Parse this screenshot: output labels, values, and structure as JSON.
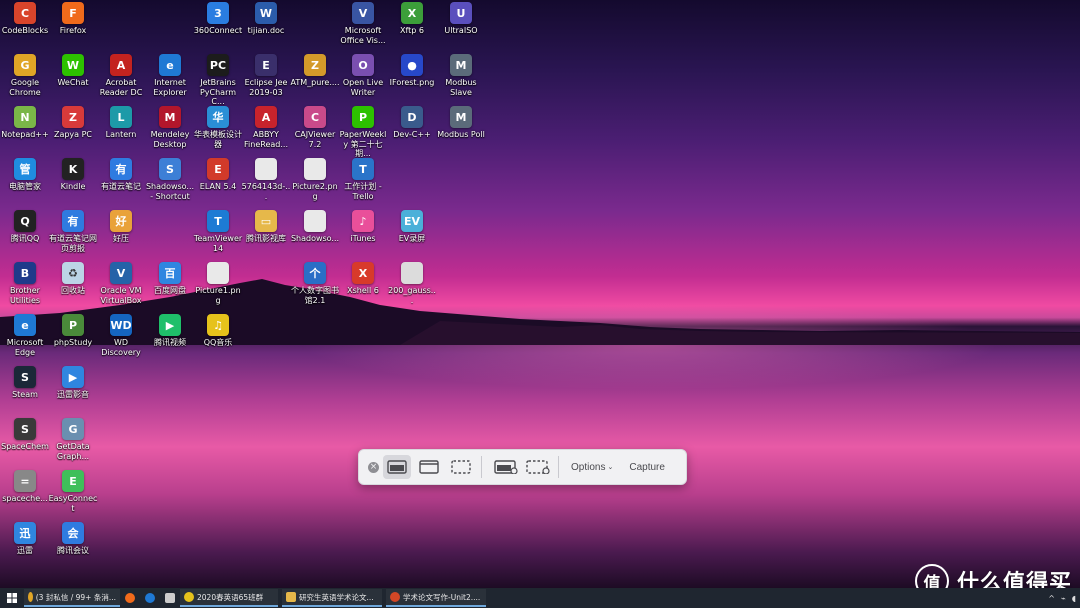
{
  "desktop": {
    "icons": [
      {
        "label": "CodeBlocks",
        "icon": "codeblocks-icon",
        "color": "#d9442b",
        "glyph": "C"
      },
      {
        "label": "Firefox",
        "icon": "firefox-icon",
        "color": "#f06a1b",
        "glyph": "F"
      },
      {
        "label": "360Connect",
        "icon": "360connect-icon",
        "color": "#2a7de1",
        "glyph": "3"
      },
      {
        "label": "tijian.doc",
        "icon": "word-doc-icon",
        "color": "#2b5cab",
        "glyph": "W"
      },
      {
        "label": "Microsoft Office Vis...",
        "icon": "visio-icon",
        "color": "#3955a3",
        "glyph": "V"
      },
      {
        "label": "Xftp 6",
        "icon": "xftp-icon",
        "color": "#3c9e3a",
        "glyph": "X"
      },
      {
        "label": "UltraISO",
        "icon": "ultraiso-icon",
        "color": "#5a4fbd",
        "glyph": "U"
      },
      {
        "label": "Google Chrome",
        "icon": "chrome-icon",
        "color": "#e0a526",
        "glyph": "G"
      },
      {
        "label": "WeChat",
        "icon": "wechat-icon",
        "color": "#2dc100",
        "glyph": "W"
      },
      {
        "label": "Acrobat Reader DC",
        "icon": "acrobat-icon",
        "color": "#c3231f",
        "glyph": "A"
      },
      {
        "label": "Internet Explorer",
        "icon": "ie-icon",
        "color": "#1f79d4",
        "glyph": "e"
      },
      {
        "label": "JetBrains PyCharm C...",
        "icon": "pycharm-icon",
        "color": "#1c1c1c",
        "glyph": "PC"
      },
      {
        "label": "Eclipse Jee 2019-03",
        "icon": "eclipse-icon",
        "color": "#3a2f6b",
        "glyph": "E"
      },
      {
        "label": "ATM_pure....",
        "icon": "archive-icon",
        "color": "#d49a2a",
        "glyph": "Z"
      },
      {
        "label": "Open Live Writer",
        "icon": "livewriter-icon",
        "color": "#7a4fb0",
        "glyph": "O"
      },
      {
        "label": "IForest.png",
        "icon": "image-file-icon",
        "color": "#2748c9",
        "glyph": "●"
      },
      {
        "label": "Modbus Slave",
        "icon": "modbus-slave-icon",
        "color": "#5b6b7a",
        "glyph": "M"
      },
      {
        "label": "Notepad++",
        "icon": "notepadpp-icon",
        "color": "#7ab648",
        "glyph": "N"
      },
      {
        "label": "Zapya PC",
        "icon": "zapya-icon",
        "color": "#d83a3a",
        "glyph": "Z"
      },
      {
        "label": "Lantern",
        "icon": "lantern-icon",
        "color": "#1d9aa8",
        "glyph": "L"
      },
      {
        "label": "Mendeley Desktop",
        "icon": "mendeley-icon",
        "color": "#b3162b",
        "glyph": "M"
      },
      {
        "label": "华表模板设计器",
        "icon": "huabiao-icon",
        "color": "#2a8fd6",
        "glyph": "华"
      },
      {
        "label": "ABBYY FineRead...",
        "icon": "abbyy-icon",
        "color": "#c8232c",
        "glyph": "A"
      },
      {
        "label": "CAJViewer 7.2",
        "icon": "cajviewer-icon",
        "color": "#c94a8a",
        "glyph": "C"
      },
      {
        "label": "PaperWeekly 第二十七期...",
        "icon": "wechat-file-icon",
        "color": "#2dc100",
        "glyph": "P"
      },
      {
        "label": "Dev-C++",
        "icon": "devcpp-icon",
        "color": "#3a5b8c",
        "glyph": "D"
      },
      {
        "label": "Modbus Poll",
        "icon": "modbus-poll-icon",
        "color": "#5b6b7a",
        "glyph": "M"
      },
      {
        "label": "电脑管家",
        "icon": "pc-manager-icon",
        "color": "#1f8ce0",
        "glyph": "管"
      },
      {
        "label": "Kindle",
        "icon": "kindle-icon",
        "color": "#222222",
        "glyph": "K"
      },
      {
        "label": "有道云笔记",
        "icon": "youdao-note-icon",
        "color": "#2f7be0",
        "glyph": "有"
      },
      {
        "label": "Shadowso... - Shortcut",
        "icon": "shadowsocks-icon",
        "color": "#3d7fd6",
        "glyph": "S"
      },
      {
        "label": "ELAN 5.4",
        "icon": "elan-icon",
        "color": "#d23a2a",
        "glyph": "E"
      },
      {
        "label": "5764143d-...",
        "icon": "blank-file-icon",
        "color": "#e9e9e9",
        "glyph": " "
      },
      {
        "label": "Picture2.png",
        "icon": "picture-file-icon",
        "color": "#e9e9e9",
        "glyph": " "
      },
      {
        "label": "工作计划 - Trello",
        "icon": "trello-icon",
        "color": "#2a74c9",
        "glyph": "T"
      },
      {
        "label": "腾讯QQ",
        "icon": "qq-icon",
        "color": "#222222",
        "glyph": "Q"
      },
      {
        "label": "有道云笔记网页剪报",
        "icon": "youdao-clip-icon",
        "color": "#2f7be0",
        "glyph": "有"
      },
      {
        "label": "好压",
        "icon": "haozip-icon",
        "color": "#e9a23a",
        "glyph": "好"
      },
      {
        "label": "TeamViewer 14",
        "icon": "teamviewer-icon",
        "color": "#1d7bd4",
        "glyph": "T"
      },
      {
        "label": "腾讯影视库",
        "icon": "folder-icon",
        "color": "#e6b84a",
        "glyph": "▭"
      },
      {
        "label": "Shadowso...",
        "icon": "text-file-icon",
        "color": "#e9e9e9",
        "glyph": " "
      },
      {
        "label": "iTunes",
        "icon": "itunes-icon",
        "color": "#e94f9a",
        "glyph": "♪"
      },
      {
        "label": "EV录屏",
        "icon": "ev-recorder-icon",
        "color": "#4bb0d9",
        "glyph": "EV"
      },
      {
        "label": "Brother Utilities",
        "icon": "brother-icon",
        "color": "#1e3a8a",
        "glyph": "B"
      },
      {
        "label": "回收站",
        "icon": "recycle-bin-icon",
        "color": "#bcd4e6",
        "glyph": "♻"
      },
      {
        "label": "Oracle VM VirtualBox",
        "icon": "virtualbox-icon",
        "color": "#2563a8",
        "glyph": "V"
      },
      {
        "label": "百度网盘",
        "icon": "baidu-pan-icon",
        "color": "#2f86e0",
        "glyph": "百"
      },
      {
        "label": "Picture1.png",
        "icon": "picture-file-icon",
        "color": "#e9e9e9",
        "glyph": " "
      },
      {
        "label": "个人数字图书馆2.1",
        "icon": "library-icon",
        "color": "#2a6ec6",
        "glyph": "个"
      },
      {
        "label": "Xshell 6",
        "icon": "xshell-icon",
        "color": "#d83a2a",
        "glyph": "X"
      },
      {
        "label": "200_gauss...",
        "icon": "image-file-icon",
        "color": "#dcdcdc",
        "glyph": " "
      },
      {
        "label": "Microsoft Edge",
        "icon": "edge-icon",
        "color": "#1f79d4",
        "glyph": "e"
      },
      {
        "label": "phpStudy",
        "icon": "phpstudy-icon",
        "color": "#4a8a3a",
        "glyph": "P"
      },
      {
        "label": "WD Discovery",
        "icon": "wd-icon",
        "color": "#1565c0",
        "glyph": "WD"
      },
      {
        "label": "腾讯视频",
        "icon": "tencent-video-icon",
        "color": "#1fbf6a",
        "glyph": "▶"
      },
      {
        "label": "QQ音乐",
        "icon": "qq-music-icon",
        "color": "#e6c21b",
        "glyph": "♫"
      },
      {
        "label": "Steam",
        "icon": "steam-icon",
        "color": "#1b2838",
        "glyph": "S"
      },
      {
        "label": "迅雷影音",
        "icon": "xunlei-player-icon",
        "color": "#2f86e0",
        "glyph": "▶"
      },
      {
        "label": "SpaceChem",
        "icon": "spacechem-icon",
        "color": "#3a3a3a",
        "glyph": "S"
      },
      {
        "label": "GetData Graph...",
        "icon": "getdata-icon",
        "color": "#6a8fb0",
        "glyph": "G"
      },
      {
        "label": "spaceche...",
        "icon": "spacechem-file-icon",
        "color": "#888888",
        "glyph": "="
      },
      {
        "label": "EasyConnect",
        "icon": "easyconnect-icon",
        "color": "#3fbf5a",
        "glyph": "E"
      },
      {
        "label": "迅雷",
        "icon": "xunlei-icon",
        "color": "#2f86e0",
        "glyph": "迅"
      },
      {
        "label": "腾讯会议",
        "icon": "tencent-meeting-icon",
        "color": "#2f7be0",
        "glyph": "会"
      }
    ]
  },
  "capture_toolbar": {
    "options_label": "Options",
    "capture_label": "Capture"
  },
  "taskbar": {
    "tasks": [
      {
        "label": "(3 封私信 / 99+ 条消...",
        "icon": "chrome-icon",
        "color": "#e0a526"
      },
      {
        "label": "2020春英语65班群",
        "icon": "qq-group-icon",
        "color": "#e6c21b"
      },
      {
        "label": "研究生英语学术论文...",
        "icon": "folder-icon",
        "color": "#e6b84a"
      },
      {
        "label": "学术论文写作-Unit2....",
        "icon": "powerpoint-icon",
        "color": "#d24726"
      }
    ],
    "pinned": [
      {
        "icon": "firefox-icon",
        "color": "#f06a1b"
      },
      {
        "icon": "edge-icon",
        "color": "#1f79d4"
      },
      {
        "icon": "settings-icon",
        "color": "#cccccc"
      }
    ]
  },
  "watermark": {
    "glyph": "值",
    "text": "什么值得买"
  }
}
